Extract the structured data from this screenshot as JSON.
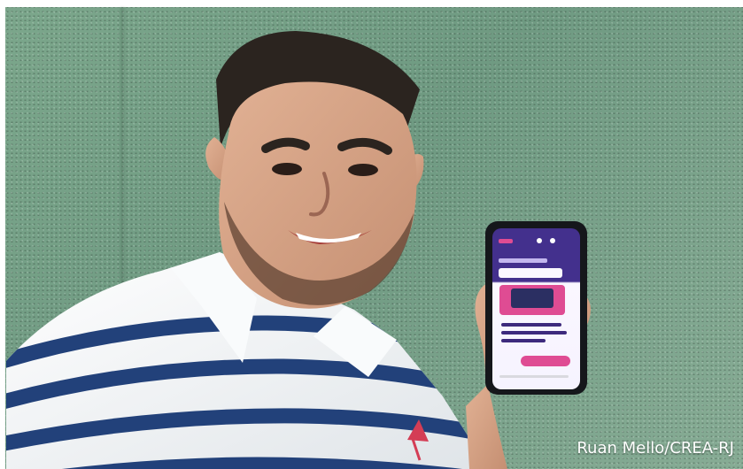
{
  "photo": {
    "credit": "Ruan Mello/CREA-RJ",
    "colors": {
      "wall": "#7ca78c",
      "hair": "#2b241f",
      "skin": "#d4a487",
      "shirt_white": "#f4f6f7",
      "shirt_stripe": "#1e3d77",
      "phone_body": "#15171b",
      "app_primary": "#3d2a7d",
      "app_accent": "#df4c93",
      "app_screen": "#f6f2ff"
    },
    "icons": [
      "phone-icon",
      "app-menu-icon",
      "notification-icon",
      "profile-icon"
    ]
  }
}
